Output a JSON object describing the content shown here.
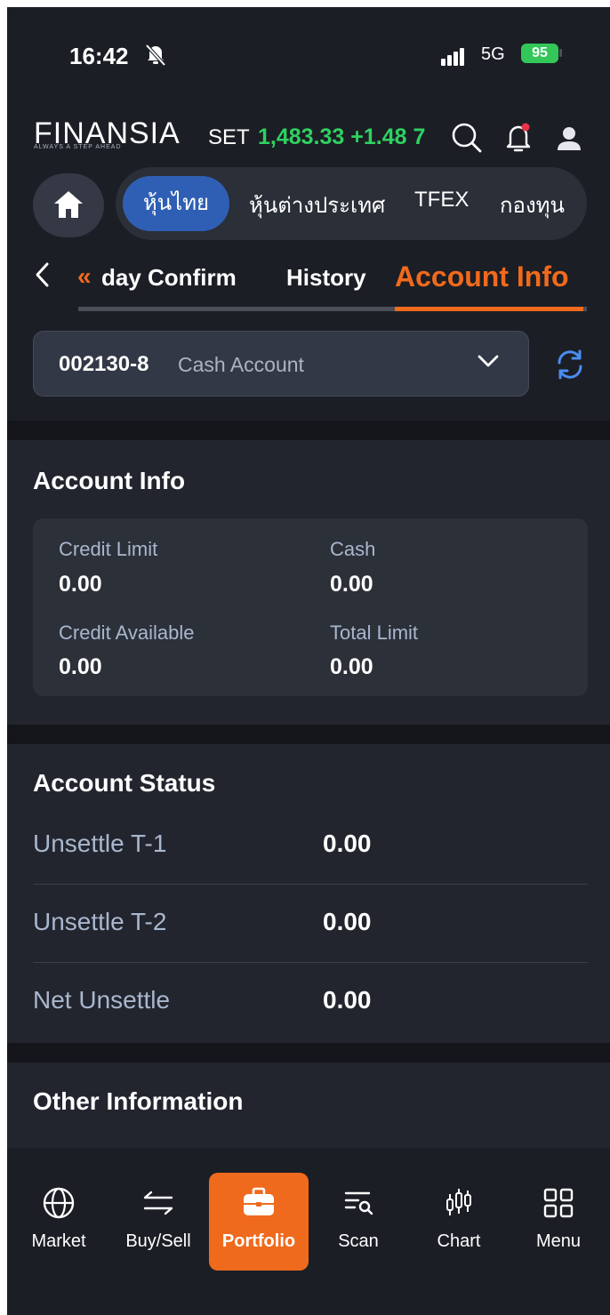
{
  "status_bar": {
    "time": "16:42",
    "network": "5G",
    "battery": "95"
  },
  "header": {
    "logo": "FINANSIA",
    "logo_tagline": "ALWAYS A STEP AHEAD",
    "index_label": "SET",
    "index_value": "1,483.33",
    "index_change": "+1.48",
    "index_change_trailing": "7",
    "accent_color": "#f06a1c",
    "up_color": "#2fd160"
  },
  "market_tabs": [
    "หุ้นไทย",
    "หุ้นต่างประเทศ",
    "TFEX",
    "กองทุน"
  ],
  "sub_tabs": {
    "prev": "day Confirm",
    "history": "History",
    "active": "Account Info"
  },
  "account_select": {
    "id": "002130-8",
    "type": "Cash Account"
  },
  "account_info": {
    "title": "Account Info",
    "credit_limit_label": "Credit Limit",
    "credit_limit": "0.00",
    "cash_label": "Cash",
    "cash": "0.00",
    "credit_available_label": "Credit Available",
    "credit_available": "0.00",
    "total_limit_label": "Total Limit",
    "total_limit": "0.00"
  },
  "account_status": {
    "title": "Account Status",
    "rows": [
      {
        "label": "Unsettle T-1",
        "value": "0.00"
      },
      {
        "label": "Unsettle T-2",
        "value": "0.00"
      },
      {
        "label": "Net Unsettle",
        "value": "0.00"
      }
    ]
  },
  "other_info": {
    "title": "Other Information"
  },
  "bottom_nav": [
    {
      "label": "Market",
      "icon": "globe-icon"
    },
    {
      "label": "Buy/Sell",
      "icon": "swap-icon"
    },
    {
      "label": "Portfolio",
      "icon": "briefcase-icon"
    },
    {
      "label": "Scan",
      "icon": "scan-icon"
    },
    {
      "label": "Chart",
      "icon": "candlestick-icon"
    },
    {
      "label": "Menu",
      "icon": "grid-icon"
    }
  ]
}
